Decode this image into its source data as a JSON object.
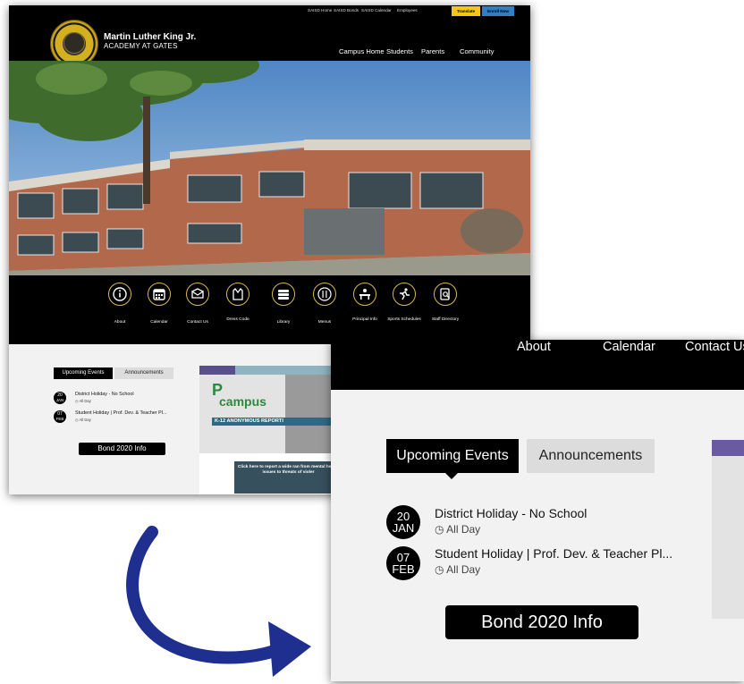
{
  "utility_nav": {
    "links": [
      "SAISD Home",
      "SAISD Bonds",
      "SAISD Calendar",
      "Employees"
    ],
    "translate": "Translate",
    "enroll": "Enroll Now"
  },
  "header": {
    "logo_text": "M.L.KING ACADEMY",
    "school_name": "Martin Luther King Jr.",
    "school_sub": "ACADEMY AT GATES",
    "nav": [
      "Campus Home",
      "Students",
      "Parents",
      "Community"
    ]
  },
  "quick_links": [
    "About",
    "Calendar",
    "Contact Us",
    "Dress Code",
    "Library",
    "Menus",
    "Principal Info",
    "Sports Schedules",
    "Staff Directory"
  ],
  "tabs": {
    "events": "Upcoming Events",
    "announcements": "Announcements"
  },
  "events": [
    {
      "day": "20",
      "month": "JAN",
      "title": "District Holiday - No School",
      "time": "All Day"
    },
    {
      "day": "07",
      "month": "FEB",
      "title": "Student Holiday | Prof. Dev. & Teacher Pl...",
      "time": "All Day"
    }
  ],
  "bond_button": "Bond 2020 Info",
  "promo": {
    "brand": "campus",
    "banner": "K-12 ANONYMOUS REPORTI",
    "cta": "Click here to report a wide ran from mental health issues to threats of violer"
  },
  "zoom_nav": [
    "About",
    "Calendar",
    "Contact Us"
  ],
  "colors": {
    "accent_gold": "#d9b84a",
    "translate_bg": "#f5c518",
    "enroll_bg": "#2f7fc6",
    "arrow": "#1e2f8f"
  }
}
